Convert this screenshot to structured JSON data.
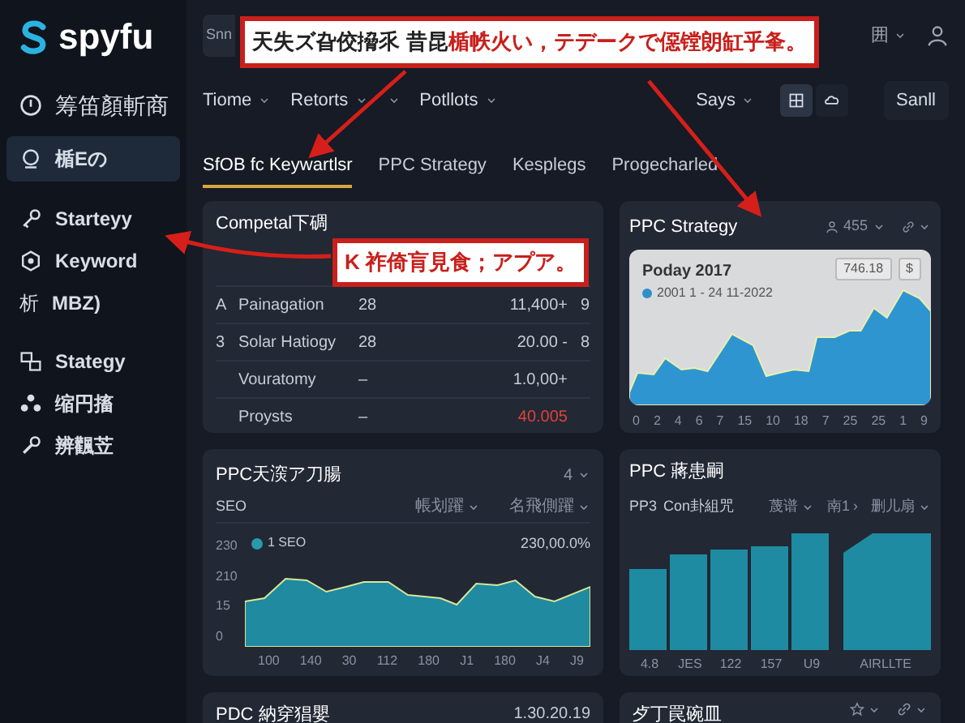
{
  "sidebar": {
    "logo": "spyfu",
    "items": [
      {
        "label": "筹笛顏斬商",
        "kind": "clock",
        "selected": false,
        "large": true
      },
      {
        "label": "楯Eの",
        "kind": "badge",
        "selected": true
      },
      {
        "label": "Starteyy",
        "kind": "key",
        "selected": false
      },
      {
        "label": "Keyword",
        "kind": "hex",
        "selected": false
      },
      {
        "label": "MBZ)",
        "kind": "glyph",
        "glyph": "析",
        "selected": false
      },
      {
        "label": "Stategy",
        "kind": "windows",
        "selected": false
      },
      {
        "label": "缩円搐",
        "kind": "people",
        "selected": false
      },
      {
        "label": "辨飌苙",
        "kind": "wrench",
        "selected": false
      }
    ]
  },
  "topbar": {
    "search": "Snn",
    "menu": "囲"
  },
  "callouts": [
    {
      "dark": "天失ズ旮佼搚乑 昔昆",
      "red": "楯帙火い，テデークで僫镗朗缸乎夆。"
    },
    {
      "red": "K 祚倚肓見食；アプア。"
    }
  ],
  "nav": {
    "menus": [
      {
        "kind": "labeled",
        "label": "Tiome"
      },
      {
        "kind": "labeled",
        "label": "Retorts"
      },
      {
        "kind": "caret"
      },
      {
        "kind": "labeled",
        "label": "Potllots"
      }
    ],
    "right_menu": "Says",
    "toggles": [
      {
        "kind": "grid",
        "selected": true
      },
      {
        "kind": "cloud",
        "selected": false
      }
    ],
    "button": "Sanll"
  },
  "tabs": [
    {
      "label": "SfOB fc Keywartlsr",
      "selected": true
    },
    {
      "label": "PPC Strategy",
      "selected": false
    },
    {
      "label": "Kesplegs",
      "selected": false
    },
    {
      "label": "Progecharled",
      "selected": false
    }
  ],
  "competitor_card": {
    "title": "Competal下碉",
    "rows": [
      {
        "rank": "A",
        "name": "Painagation",
        "count": "28",
        "value": "11,400+",
        "column_5": "9",
        "negative": false
      },
      {
        "rank": "3",
        "name": "Solar Hatiogy",
        "count": "28",
        "value": "20.00 -",
        "column_5": "8",
        "negative": false
      },
      {
        "name": "Vouratomy",
        "count": "–",
        "value": "1.0,00+",
        "negative": false
      },
      {
        "name": "Proysts",
        "count": "–",
        "value": "40.005",
        "negative": true
      }
    ]
  },
  "strategy_card": {
    "title": "PPC Strategy",
    "filter": "455",
    "panel_title": "Poday 2017",
    "legend": "2001 1 - 24 11-2022",
    "buttons": [
      "746.18",
      "$"
    ],
    "x_labels": [
      "0",
      "2",
      "4",
      "6",
      "7",
      "15",
      "10",
      "18",
      "7",
      "25",
      "25",
      "1",
      "9"
    ]
  },
  "seo_card": {
    "title": "PPC天㴱ア刀腸",
    "menu": "4",
    "row_label": "SEO",
    "filters": [
      "帳划躍",
      "名飛側躍"
    ],
    "legend": "1 SEO",
    "reading": "230,00.0%",
    "y_labels": [
      "230",
      "210",
      "15",
      "0"
    ],
    "x_labels": [
      "100",
      "140",
      "30",
      "112",
      "180",
      "J1",
      "180",
      "J4",
      "J9"
    ]
  },
  "bars_card": {
    "title": "PPC 蔣患嗣",
    "labels": [
      "PP3",
      "Con卦組咒"
    ],
    "filters": [
      {
        "label": "蔑谱",
        "kind": "dropdown"
      },
      {
        "label": "南1",
        "kind": "next",
        "glyph": "›"
      },
      {
        "label": "删儿扇",
        "kind": "dropdown"
      }
    ],
    "x_labels": [
      "4.8",
      "JES",
      "122",
      "157",
      "U9",
      "AIRLLTE"
    ]
  },
  "bottom_cards": [
    {
      "title": "PDC 納穿猖嬰",
      "value": "1.30.20.19"
    },
    {
      "title": "歺丁罠碗皿",
      "menus": [
        {
          "kind": "star"
        },
        {
          "kind": "link"
        }
      ]
    }
  ]
}
